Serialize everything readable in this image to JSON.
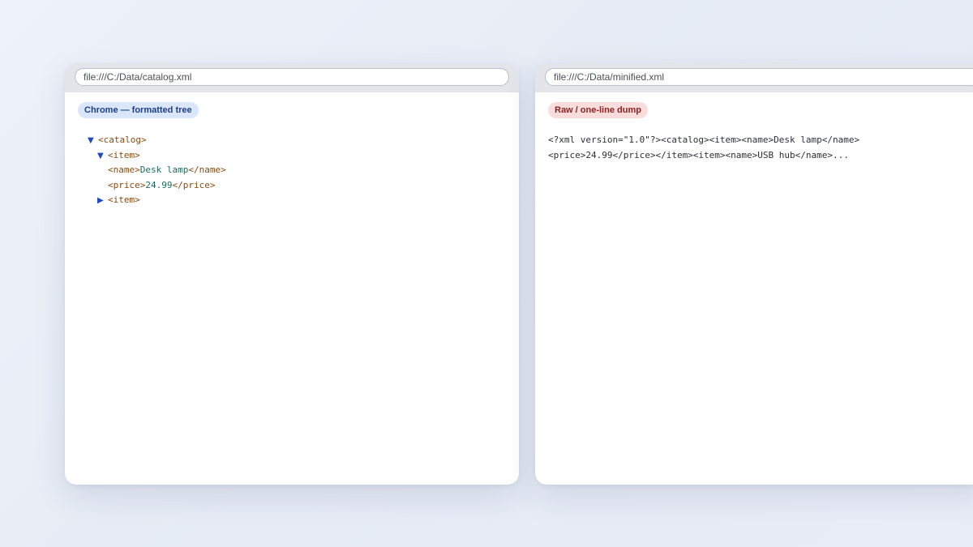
{
  "left_window": {
    "address": "file:///C:/Data/catalog.xml",
    "badge": "Chrome — formatted tree",
    "tree": {
      "catalog_open": "<catalog>",
      "item_open": "<item>",
      "name_open": "<name>",
      "name_value": "Desk lamp",
      "name_close": "</name>",
      "price_open": "<price>",
      "price_value": "24.99",
      "price_close": "</price>",
      "item2_open": "<item>",
      "expanded_toggle": "▼",
      "collapsed_toggle": "▶"
    }
  },
  "right_window": {
    "address": "file:///C:/Data/minified.xml",
    "badge": "Raw / one-line dump",
    "raw_lines": [
      "<?xml version=\"1.0\"?><catalog><item><name>Desk lamp</name>",
      "<price>24.99</price></item><item><name>USB hub</name>..."
    ]
  },
  "colors": {
    "badge_blue_bg": "#d9e6fb",
    "badge_red_bg": "#f9dcdc",
    "tag_color": "#8a4b0f",
    "text_color": "#1d6b5c",
    "toggle_color": "#2049c4"
  }
}
